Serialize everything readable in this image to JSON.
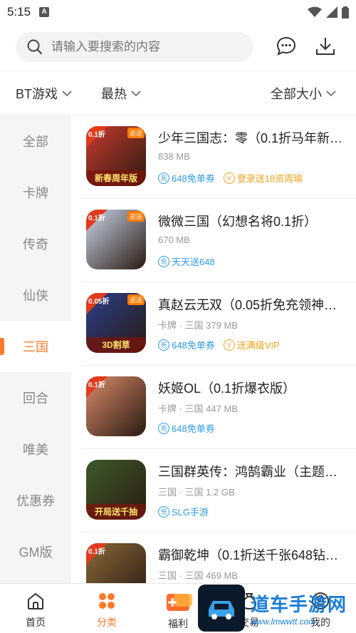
{
  "status_bar": {
    "time": "5:15",
    "notif_letter": "A"
  },
  "search": {
    "placeholder": "请输入要搜索的内容"
  },
  "filters": {
    "type": "BT游戏",
    "sort": "最热",
    "size": "全部大小"
  },
  "sidebar": {
    "items": [
      {
        "label": "全部"
      },
      {
        "label": "卡牌"
      },
      {
        "label": "传奇"
      },
      {
        "label": "仙侠"
      },
      {
        "label": "三国"
      },
      {
        "label": "回合"
      },
      {
        "label": "唯美"
      },
      {
        "label": "优惠券"
      },
      {
        "label": "GM版"
      }
    ],
    "active_index": 4
  },
  "games": [
    {
      "title": "少年三国志：零（0.1折马年新…",
      "meta": "838 MB",
      "icon_corner": "0.1折",
      "icon_tag": "返送",
      "icon_banner": "新春周年版",
      "tags": [
        {
          "label": "648免单券",
          "kind": "blue",
          "glyph": "充"
        },
        {
          "label": "登录送18资周瑜",
          "kind": "gold",
          "glyph": "V"
        }
      ],
      "color": "#c93b2f"
    },
    {
      "title": "微微三国（幻想名将0.1折）",
      "meta": "670 MB",
      "icon_corner": "0.1折",
      "icon_tag": "返送",
      "icon_banner": "",
      "tags": [
        {
          "label": "天天送648",
          "kind": "blue",
          "glyph": "充"
        }
      ],
      "color": "#c9d4e8"
    },
    {
      "title": "真赵云无双（0.05折免充领神…",
      "meta": "卡牌 · 三国  379 MB",
      "icon_corner": "0.05折",
      "icon_tag": "返送",
      "icon_banner": "3D割草",
      "tags": [
        {
          "label": "648免单券",
          "kind": "blue",
          "glyph": "充"
        },
        {
          "label": "送满级VIP",
          "kind": "gold",
          "glyph": "V"
        }
      ],
      "color": "#2a3f8a"
    },
    {
      "title": "妖姬OL（0.1折爆衣版）",
      "meta": "卡牌 · 三国  447 MB",
      "icon_corner": "0.1折",
      "icon_tag": "",
      "icon_banner": "",
      "tags": [
        {
          "label": "648免单券",
          "kind": "blue",
          "glyph": "充"
        }
      ],
      "color": "#d98c6a"
    },
    {
      "title": "三国群英传：鸿鹄霸业（主题…",
      "meta": "三国 · 三国  1.2 GB",
      "icon_corner": "",
      "icon_tag": "",
      "icon_banner": "开局送千抽",
      "tags": [
        {
          "label": "SLG手游",
          "kind": "blue",
          "glyph": "充"
        }
      ],
      "color": "#3d5a2a"
    },
    {
      "title": "霸御乾坤（0.1折送千张648钻…",
      "meta": "三国 · 三国  469 MB",
      "icon_corner": "0.1折",
      "icon_tag": "",
      "icon_banner": "",
      "tags": [],
      "color": "#8a6a3a"
    }
  ],
  "bottom_nav": {
    "items": [
      {
        "label": "首页"
      },
      {
        "label": "分类"
      },
      {
        "label": "福利"
      },
      {
        "label": "交易"
      },
      {
        "label": "我的"
      }
    ],
    "active_index": 1
  },
  "watermark": {
    "title": "道车手游网",
    "url": "www.lmwwtt.com"
  },
  "colors": {
    "accent": "#ff7a2a",
    "blue": "#2d9be8",
    "gold": "#f0a21a"
  }
}
